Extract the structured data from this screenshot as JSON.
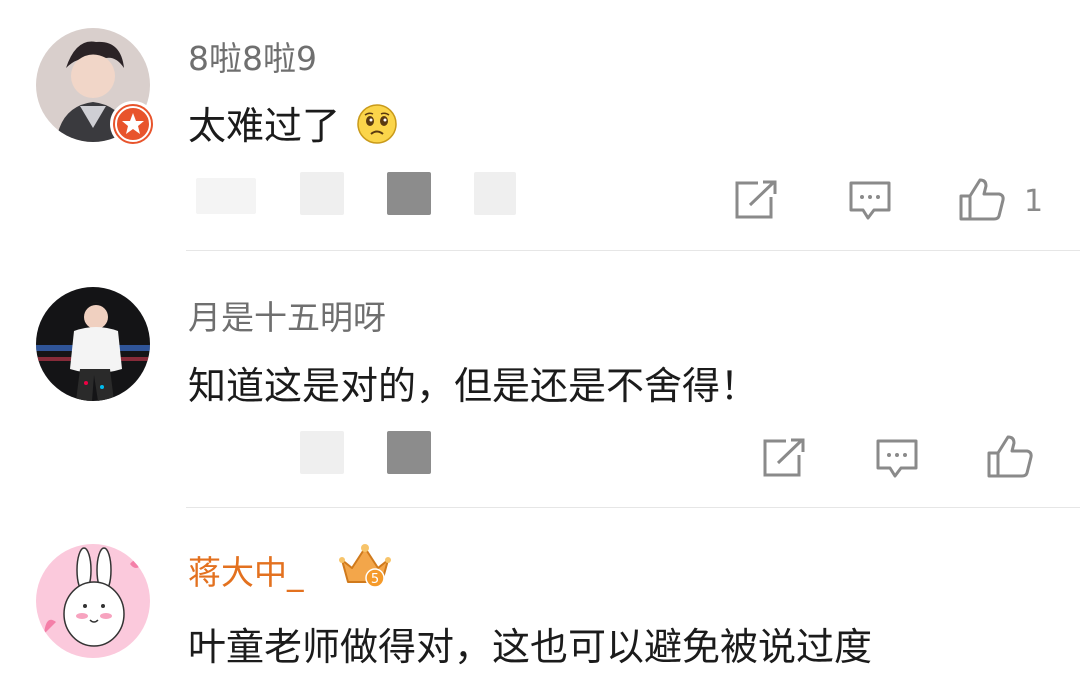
{
  "comments": [
    {
      "username": "8啦8啦9",
      "text": "太难过了",
      "emoji": "crying-face-icon",
      "likes": "1"
    },
    {
      "username": "月是十五明呀",
      "text": "知道这是对的，但是还是不舍得！"
    },
    {
      "username": "蒋大中_",
      "badge_level": "5",
      "text": "叶童老师做得对，这也可以避免被说过度"
    }
  ],
  "colors": {
    "username_gray": "#6f6f6f",
    "username_gold": "#e3711f",
    "text": "#1b1b1b",
    "icon": "#8a8a8a",
    "vip_badge": "#e8542c"
  }
}
